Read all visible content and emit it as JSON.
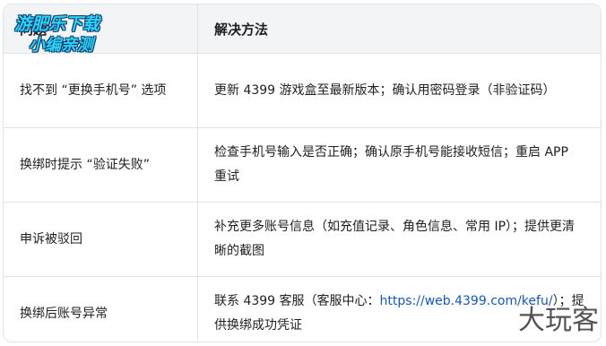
{
  "table": {
    "header": {
      "col1": "问题",
      "col2": "解决方法"
    },
    "rows": [
      {
        "problem": "找不到 “更换手机号” 选项",
        "solution": "更新 4399 游戏盒至最新版本；确认用密码登录（非验证码）"
      },
      {
        "problem": "换绑时提示 “验证失败”",
        "solution": "检查手机号输入是否正确；确认原手机号能接收短信；重启 APP 重试"
      },
      {
        "problem": "申诉被驳回",
        "solution": "补充更多账号信息（如充值记录、角色信息、常用 IP）；提供更清晰的截图"
      },
      {
        "problem": "换绑后账号异常",
        "solution_prefix": "联系 4399 客服（客服中心：",
        "solution_link": "https://web.4399.com/kefu/",
        "solution_suffix": "）；提供换绑成功凭证"
      }
    ]
  },
  "watermarks": {
    "top_left_line1": "游肥乐下载",
    "top_left_line2": "小编亲测",
    "bottom_right": "大玩客"
  },
  "colors": {
    "header_bg": "#f3f4f6",
    "border": "#e3e3e3",
    "link": "#1a56b3"
  }
}
